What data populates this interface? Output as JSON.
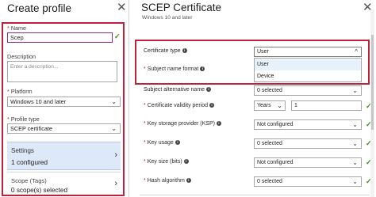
{
  "create_profile": {
    "title": "Create profile",
    "close_glyph": "✕",
    "name_label": "Name",
    "name_value": "Scep",
    "description_label": "Description",
    "description_placeholder": "Enter a description...",
    "platform_label": "Platform",
    "platform_value": "Windows 10 and later",
    "profile_type_label": "Profile type",
    "profile_type_value": "SCEP certificate",
    "settings_label": "Settings",
    "settings_value": "1 configured",
    "scope_label": "Scope (Tags)",
    "scope_value": "0 scope(s) selected",
    "required_marker": "*",
    "check_glyph": "✓",
    "chevron_down": "⌄",
    "chevron_right": "›"
  },
  "scep_certificate": {
    "title": "SCEP Certificate",
    "subtitle": "Windows 10 and later",
    "close_glyph": "✕",
    "info_glyph": "i",
    "fields": {
      "certificate_type": {
        "label": "Certificate type",
        "value": "User"
      },
      "subject_name_format": {
        "label": "Subject name format"
      },
      "subject_alt_name": {
        "label": "Subject alternative name",
        "value": "0 selected"
      },
      "validity_period": {
        "label": "Certificate validity period",
        "unit": "Years",
        "number": "1"
      },
      "ksp": {
        "label": "Key storage provider (KSP)",
        "value": "Not configured"
      },
      "key_usage": {
        "label": "Key usage",
        "value": "0 selected"
      },
      "key_size": {
        "label": "Key size (bits)",
        "value": "Not configured"
      },
      "hash_algorithm": {
        "label": "Hash algorithm",
        "value": "0 selected"
      }
    },
    "certificate_type_options": [
      "User",
      "Device"
    ]
  },
  "colors": {
    "highlight": "#c0213a",
    "check": "#3c8a1e",
    "selected_tile": "#dde9f8",
    "selected_option": "#e5f1fb"
  },
  "icons": [
    "close-icon",
    "info-icon",
    "chevron-down-icon",
    "chevron-right-icon",
    "checkmark-icon"
  ]
}
